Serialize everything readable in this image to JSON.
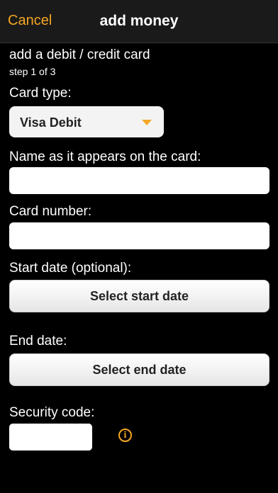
{
  "nav": {
    "cancel_label": "Cancel",
    "title": "add money"
  },
  "form": {
    "heading": "add a debit / credit card",
    "step": "step 1 of 3",
    "card_type_label": "Card type:",
    "card_type_value": "Visa Debit",
    "name_label": "Name as it appears on the card:",
    "name_value": "",
    "card_number_label": "Card number:",
    "card_number_value": "",
    "start_date_label": "Start date (optional):",
    "start_date_button": "Select start date",
    "end_date_label": "End date:",
    "end_date_button": "Select end date",
    "security_code_label": "Security code:",
    "security_code_value": "",
    "info_icon_glyph": "i"
  },
  "colors": {
    "accent": "#f5a623",
    "background": "#000000",
    "field": "#ffffff"
  },
  "icons": {
    "select_arrow": "triangle-down-icon",
    "info": "info-icon"
  }
}
